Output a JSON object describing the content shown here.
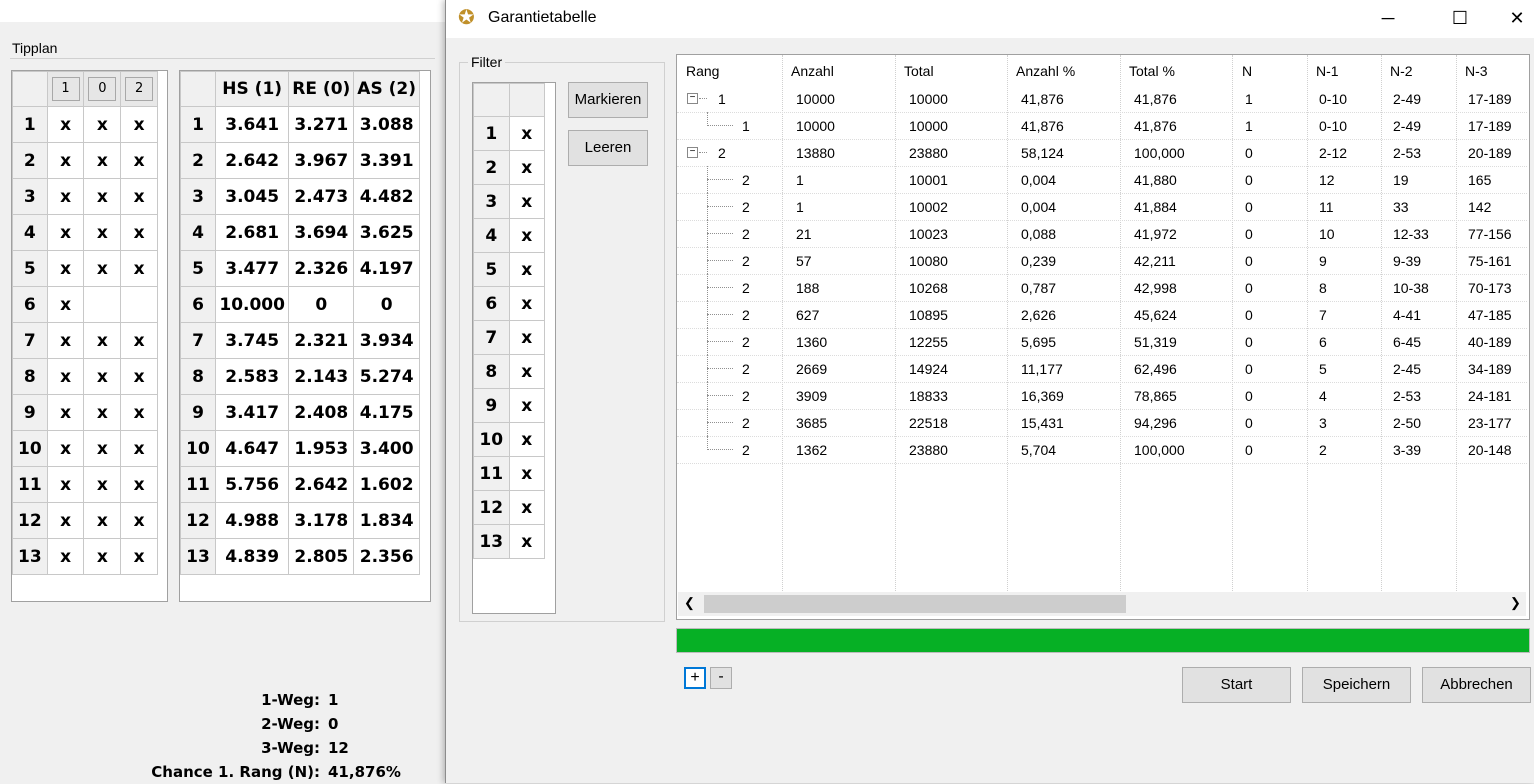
{
  "background": {
    "group_label": "Tipplan",
    "tip_header": [
      "1",
      "0",
      "2"
    ],
    "tip_rows": [
      {
        "n": "1",
        "c": [
          "x",
          "x",
          "x"
        ]
      },
      {
        "n": "2",
        "c": [
          "x",
          "x",
          "x"
        ]
      },
      {
        "n": "3",
        "c": [
          "x",
          "x",
          "x"
        ]
      },
      {
        "n": "4",
        "c": [
          "x",
          "x",
          "x"
        ]
      },
      {
        "n": "5",
        "c": [
          "x",
          "x",
          "x"
        ]
      },
      {
        "n": "6",
        "c": [
          "x",
          "",
          ""
        ]
      },
      {
        "n": "7",
        "c": [
          "x",
          "x",
          "x"
        ]
      },
      {
        "n": "8",
        "c": [
          "x",
          "x",
          "x"
        ]
      },
      {
        "n": "9",
        "c": [
          "x",
          "x",
          "x"
        ]
      },
      {
        "n": "10",
        "c": [
          "x",
          "x",
          "x"
        ]
      },
      {
        "n": "11",
        "c": [
          "x",
          "x",
          "x"
        ]
      },
      {
        "n": "12",
        "c": [
          "x",
          "x",
          "x"
        ]
      },
      {
        "n": "13",
        "c": [
          "x",
          "x",
          "x"
        ]
      }
    ],
    "odds_header": [
      "HS (1)",
      "RE (0)",
      "AS (2)"
    ],
    "odds_rows": [
      {
        "n": "1",
        "c": [
          "3.641",
          "3.271",
          "3.088"
        ]
      },
      {
        "n": "2",
        "c": [
          "2.642",
          "3.967",
          "3.391"
        ]
      },
      {
        "n": "3",
        "c": [
          "3.045",
          "2.473",
          "4.482"
        ]
      },
      {
        "n": "4",
        "c": [
          "2.681",
          "3.694",
          "3.625"
        ]
      },
      {
        "n": "5",
        "c": [
          "3.477",
          "2.326",
          "4.197"
        ]
      },
      {
        "n": "6",
        "c": [
          "10.000",
          "0",
          "0"
        ]
      },
      {
        "n": "7",
        "c": [
          "3.745",
          "2.321",
          "3.934"
        ]
      },
      {
        "n": "8",
        "c": [
          "2.583",
          "2.143",
          "5.274"
        ]
      },
      {
        "n": "9",
        "c": [
          "3.417",
          "2.408",
          "4.175"
        ]
      },
      {
        "n": "10",
        "c": [
          "4.647",
          "1.953",
          "3.400"
        ]
      },
      {
        "n": "11",
        "c": [
          "5.756",
          "2.642",
          "1.602"
        ]
      },
      {
        "n": "12",
        "c": [
          "4.988",
          "3.178",
          "1.834"
        ]
      },
      {
        "n": "13",
        "c": [
          "4.839",
          "2.805",
          "2.356"
        ]
      }
    ],
    "stats": [
      {
        "label": "1-Weg:",
        "value": "1"
      },
      {
        "label": "2-Weg:",
        "value": "0"
      },
      {
        "label": "3-Weg:",
        "value": "12"
      },
      {
        "label": "Chance 1. Rang (N):",
        "value": "41,876%"
      }
    ]
  },
  "dialog": {
    "title": "Garantietabelle",
    "icon": "trophy-icon",
    "controls": {
      "minimize": "─",
      "maximize": "☐",
      "close": "✕"
    },
    "filter": {
      "label": "Filter",
      "rows": [
        {
          "n": "1",
          "v": "x"
        },
        {
          "n": "2",
          "v": "x"
        },
        {
          "n": "3",
          "v": "x"
        },
        {
          "n": "4",
          "v": "x"
        },
        {
          "n": "5",
          "v": "x"
        },
        {
          "n": "6",
          "v": "x"
        },
        {
          "n": "7",
          "v": "x"
        },
        {
          "n": "8",
          "v": "x"
        },
        {
          "n": "9",
          "v": "x"
        },
        {
          "n": "10",
          "v": "x"
        },
        {
          "n": "11",
          "v": "x"
        },
        {
          "n": "12",
          "v": "x"
        },
        {
          "n": "13",
          "v": "x"
        }
      ],
      "mark_label": "Markieren",
      "clear_label": "Leeren"
    },
    "tree": {
      "columns": [
        "Rang",
        "Anzahl",
        "Total",
        "Anzahl %",
        "Total %",
        "N",
        "N-1",
        "N-2",
        "N-3"
      ],
      "rows": [
        {
          "level": 0,
          "expander": "−",
          "c": [
            "1",
            "10000",
            "10000",
            "41,876",
            "41,876",
            "1",
            "0-10",
            "2-49",
            "17-189"
          ]
        },
        {
          "level": 1,
          "last": true,
          "c": [
            "1",
            "10000",
            "10000",
            "41,876",
            "41,876",
            "1",
            "0-10",
            "2-49",
            "17-189"
          ]
        },
        {
          "level": 0,
          "expander": "−",
          "c": [
            "2",
            "13880",
            "23880",
            "58,124",
            "100,000",
            "0",
            "2-12",
            "2-53",
            "20-189"
          ]
        },
        {
          "level": 1,
          "c": [
            "2",
            "1",
            "10001",
            "0,004",
            "41,880",
            "0",
            "12",
            "19",
            "165"
          ]
        },
        {
          "level": 1,
          "c": [
            "2",
            "1",
            "10002",
            "0,004",
            "41,884",
            "0",
            "11",
            "33",
            "142"
          ]
        },
        {
          "level": 1,
          "c": [
            "2",
            "21",
            "10023",
            "0,088",
            "41,972",
            "0",
            "10",
            "12-33",
            "77-156"
          ]
        },
        {
          "level": 1,
          "c": [
            "2",
            "57",
            "10080",
            "0,239",
            "42,211",
            "0",
            "9",
            "9-39",
            "75-161"
          ]
        },
        {
          "level": 1,
          "c": [
            "2",
            "188",
            "10268",
            "0,787",
            "42,998",
            "0",
            "8",
            "10-38",
            "70-173"
          ]
        },
        {
          "level": 1,
          "c": [
            "2",
            "627",
            "10895",
            "2,626",
            "45,624",
            "0",
            "7",
            "4-41",
            "47-185"
          ]
        },
        {
          "level": 1,
          "c": [
            "2",
            "1360",
            "12255",
            "5,695",
            "51,319",
            "0",
            "6",
            "6-45",
            "40-189"
          ]
        },
        {
          "level": 1,
          "c": [
            "2",
            "2669",
            "14924",
            "11,177",
            "62,496",
            "0",
            "5",
            "2-45",
            "34-189"
          ]
        },
        {
          "level": 1,
          "c": [
            "2",
            "3909",
            "18833",
            "16,369",
            "78,865",
            "0",
            "4",
            "2-53",
            "24-181"
          ]
        },
        {
          "level": 1,
          "c": [
            "2",
            "3685",
            "22518",
            "15,431",
            "94,296",
            "0",
            "3",
            "2-50",
            "23-177"
          ]
        },
        {
          "level": 1,
          "last": true,
          "c": [
            "2",
            "1362",
            "23880",
            "5,704",
            "100,000",
            "0",
            "2",
            "3-39",
            "20-148"
          ]
        }
      ]
    },
    "scroll": {
      "left": "❮",
      "right": "❯"
    },
    "progress": {
      "fraction": 1.0,
      "color": "#06b025"
    },
    "expand_all": "+",
    "collapse_all": "-",
    "buttons": {
      "start": "Start",
      "save": "Speichern",
      "cancel": "Abbrechen"
    }
  }
}
